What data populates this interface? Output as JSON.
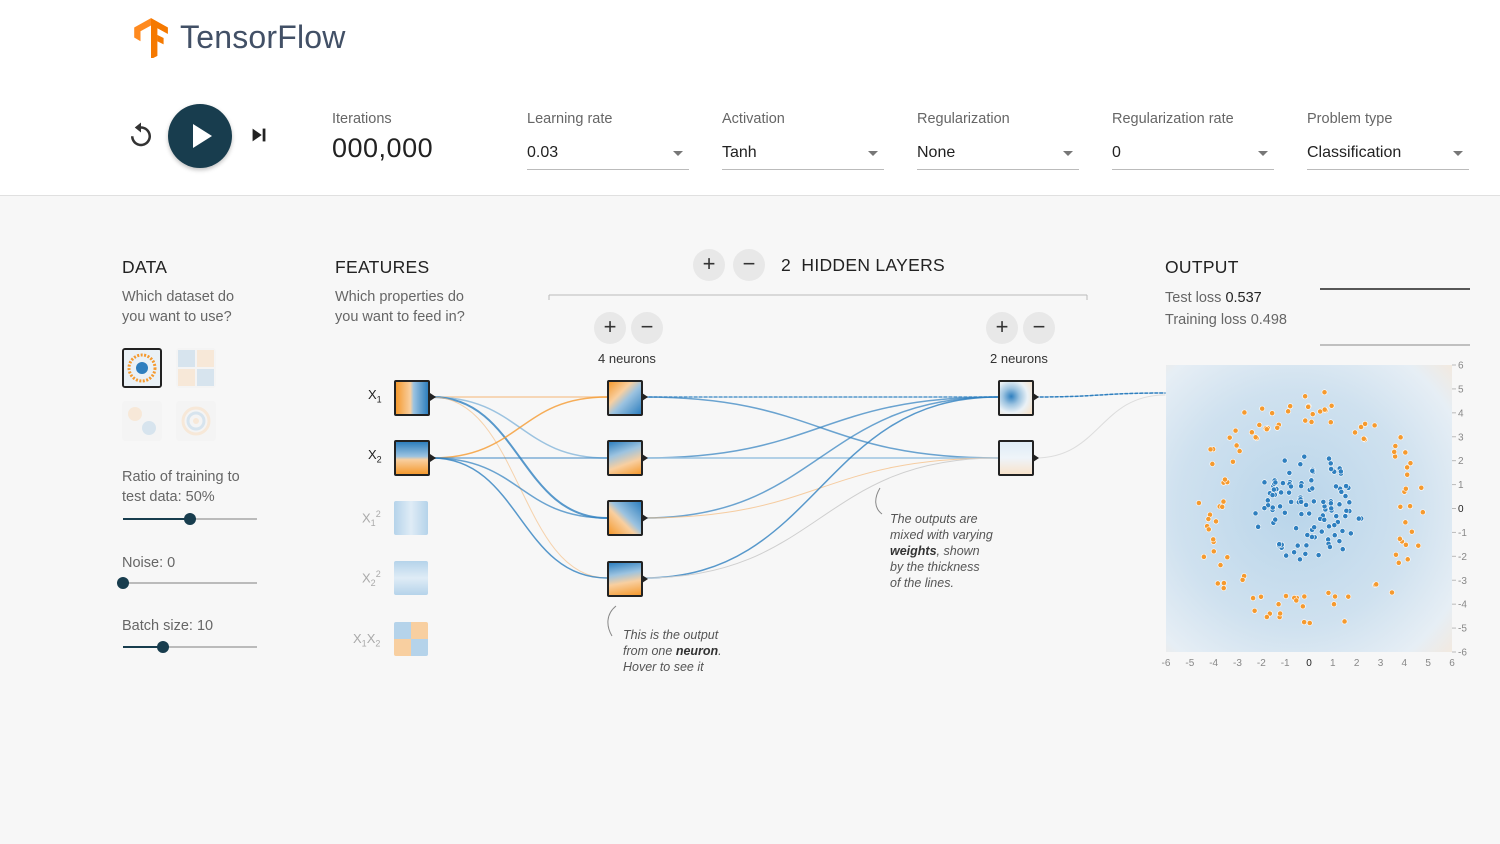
{
  "app": {
    "title": "TensorFlow"
  },
  "controls": {
    "iterations_label": "Iterations",
    "iterations_value": "000,000",
    "learning_rate": {
      "label": "Learning rate",
      "value": "0.03"
    },
    "activation": {
      "label": "Activation",
      "value": "Tanh"
    },
    "regularization": {
      "label": "Regularization",
      "value": "None"
    },
    "regularization_rate": {
      "label": "Regularization rate",
      "value": "0"
    },
    "problem_type": {
      "label": "Problem type",
      "value": "Classification"
    }
  },
  "data": {
    "title": "DATA",
    "subtitle_line1": "Which dataset do",
    "subtitle_line2": "you want to use?",
    "ratio_line1": "Ratio of training to",
    "ratio_line2": "test data:  50%",
    "ratio_value": 0.5,
    "noise_label": "Noise:  0",
    "noise_value": 0,
    "batch_label": "Batch size:  10",
    "batch_value": 0.3
  },
  "features": {
    "title": "FEATURES",
    "subtitle_line1": "Which properties do",
    "subtitle_line2": "you want to feed in?",
    "items": [
      {
        "label": "X",
        "sub": "1",
        "sup": ""
      },
      {
        "label": "X",
        "sub": "2",
        "sup": ""
      },
      {
        "label": "X",
        "sub": "1",
        "sup": "2"
      },
      {
        "label": "X",
        "sub": "2",
        "sup": "2"
      },
      {
        "label": "X",
        "sub": "1",
        "sup": "",
        "label2": "X",
        "sub2": "2"
      }
    ]
  },
  "hidden": {
    "count": "2",
    "title": "HIDDEN LAYERS",
    "layer1_neurons": "4 neurons",
    "layer2_neurons": "2 neurons",
    "plus": "+",
    "minus": "−"
  },
  "callouts": {
    "neuron": [
      "This is the output",
      "from one ",
      "neuron",
      ".",
      "Hover to see it"
    ],
    "weights": [
      "The outputs are",
      "mixed with varying",
      "weights",
      ", shown",
      "by the thickness",
      "of the lines."
    ]
  },
  "output": {
    "title": "OUTPUT",
    "test_loss_label": "Test loss ",
    "test_loss_value": "0.537",
    "training_loss_label": "Training loss ",
    "training_loss_value": "0.498",
    "x_ticks": [
      "-6",
      "-5",
      "-4",
      "-3",
      "-2",
      "-1",
      "0",
      "1",
      "2",
      "3",
      "4",
      "5",
      "6"
    ],
    "y_ticks": [
      "6",
      "5",
      "4",
      "3",
      "2",
      "1",
      "0",
      "-1",
      "-2",
      "-3",
      "-4",
      "-5",
      "-6"
    ]
  },
  "colors": {
    "blue": "#2e7fbf",
    "orange": "#f59a2f",
    "dark": "#183d4e"
  }
}
